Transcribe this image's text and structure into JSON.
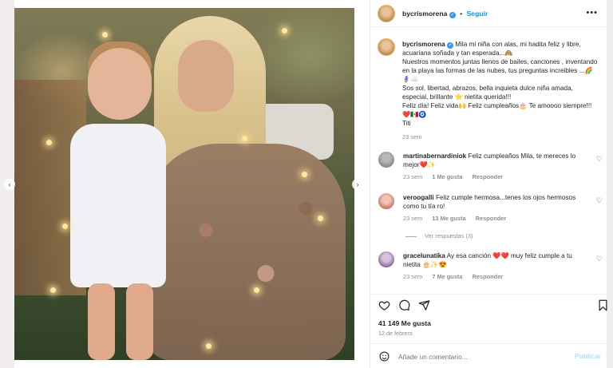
{
  "post": {
    "author": "bycrismorena",
    "follow_label": "Seguir",
    "more_label": "•••"
  },
  "caption": {
    "username": "bycrismorena",
    "line1": "Mila mi niña con alas, mi hadita feliz y libre, acuariana soñada y tan esperada...🙈",
    "line2": "Nuestros momentos juntas llenos de bailes, canciones , inventando en la playa las formas de las nubes, tus preguntas increibles ...🌈",
    "line3": "🪻☁️",
    "line4": "Sos sol, libertad, abrazos, bella inquieta dulce niña amada, especial, brillante ⭐ nietita querida!!!",
    "line5": "Feliz día! Feliz vida🙌 Feliz cumpleaños🎂 Te amoooo siempre!!!",
    "line6": "❤️🇲🇽🧿",
    "line7": "Titi",
    "time": "23 sem"
  },
  "comments": [
    {
      "username": "martinabernardiniok",
      "text": "Feliz cumpleaños Mila, te mereces lo mejor❤️✨",
      "time": "23 sem",
      "likes": "1 Me gusta",
      "reply": "Responder"
    },
    {
      "username": "veroogalli",
      "text": "Feliz cumple hermosa...tenes los ojos hermosos como tu tía ro!",
      "time": "23 sem",
      "likes": "13 Me gusta",
      "reply": "Responder",
      "view_replies": "Ver respuestas (3)"
    },
    {
      "username": "gracelunatika",
      "text": "Ay esa canción ❤️❤️ muy feliz cumple a tu nietita 🎂✨😍",
      "time": "23 sem",
      "likes": "7 Me gusta",
      "reply": "Responder"
    }
  ],
  "stats": {
    "likes": "41 149 Me gusta",
    "date": "12 de febrero"
  },
  "add_comment": {
    "placeholder": "Añade un comentario...",
    "publish": "Publicar"
  },
  "icons": {
    "heart": "heart-icon",
    "comment": "comment-icon",
    "share": "share-icon",
    "save": "bookmark-icon",
    "emoji": "emoji-icon",
    "prev": "chevron-left-icon",
    "next": "chevron-right-icon"
  },
  "colors": {
    "accent": "#0095f6",
    "verified": "#3897f0",
    "muted": "#8e8e8e"
  }
}
